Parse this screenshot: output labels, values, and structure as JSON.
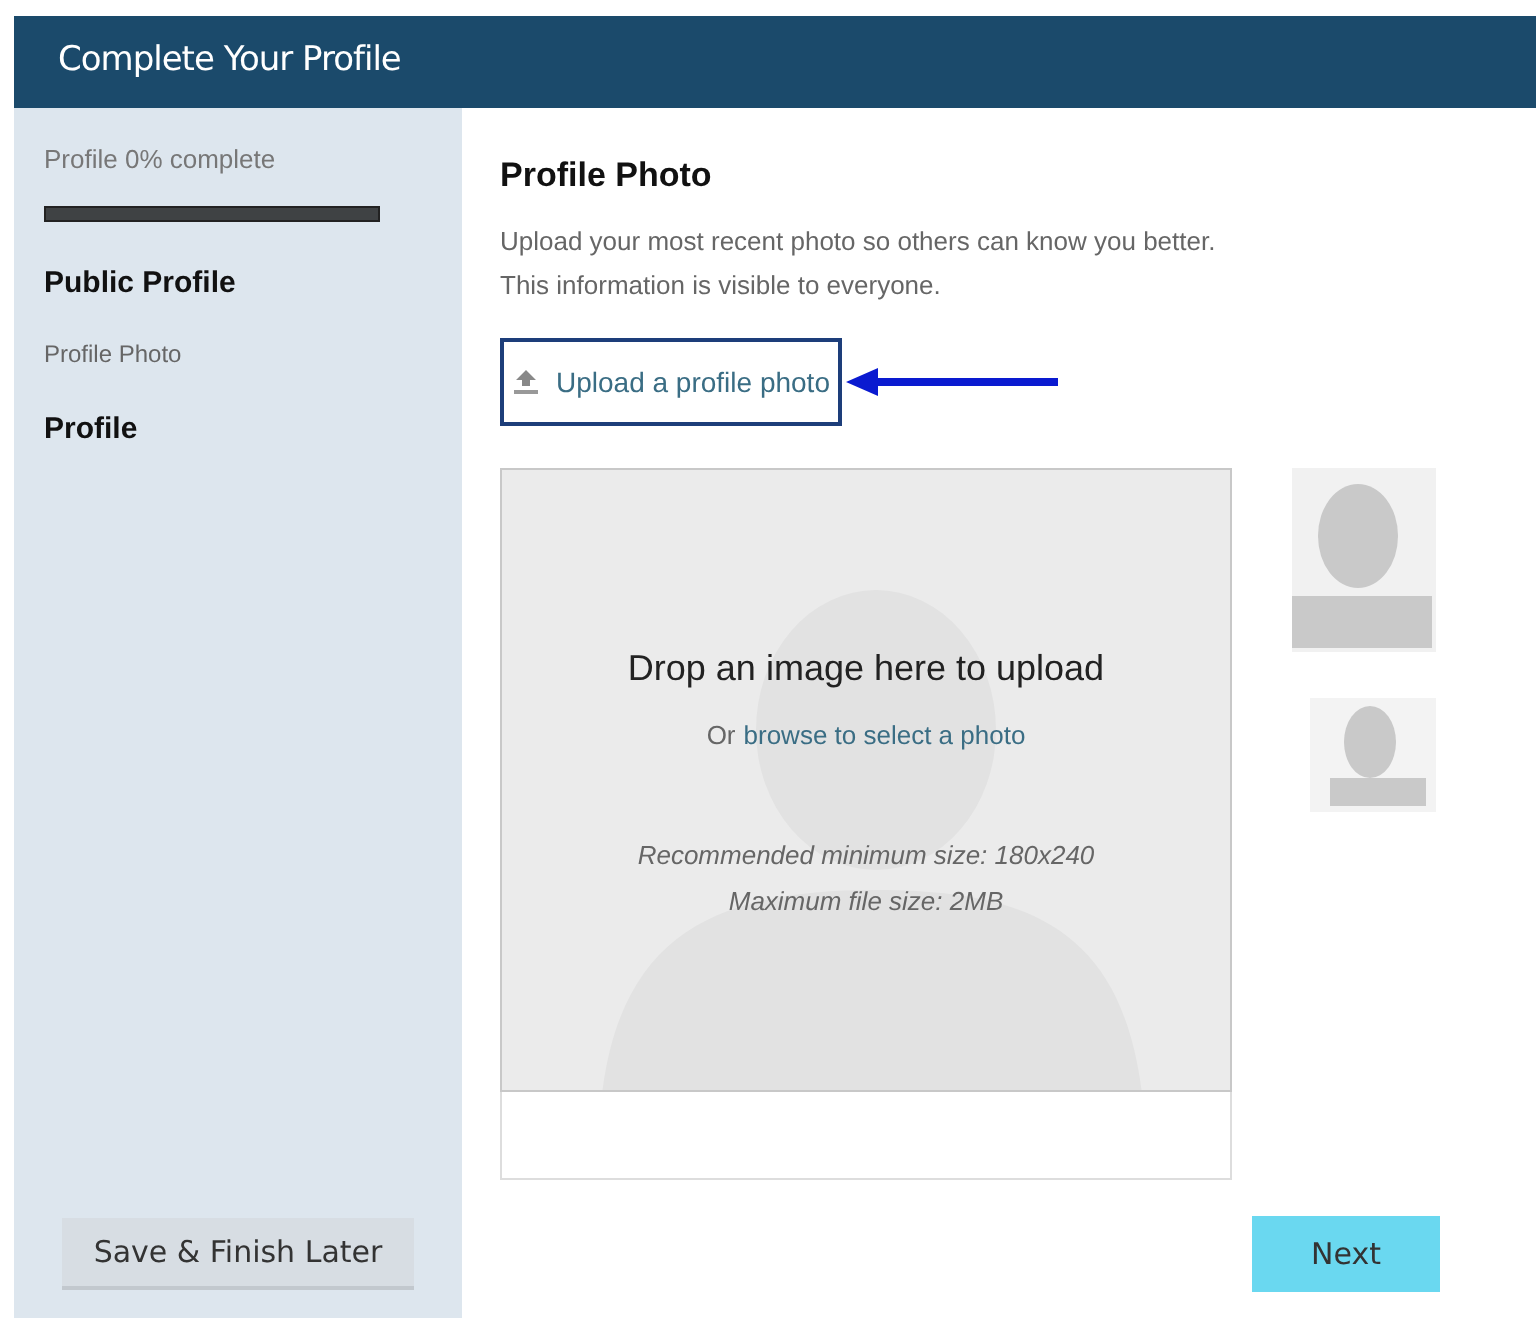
{
  "header": {
    "title": "Complete Your Profile"
  },
  "sidebar": {
    "progress_label": "Profile 0% complete",
    "progress": {
      "level": 0
    },
    "items": [
      {
        "kind": "section",
        "label": "Public Profile"
      },
      {
        "kind": "step",
        "label": "Profile Photo"
      },
      {
        "kind": "section",
        "label": "Profile"
      }
    ],
    "save_button": "Save & Finish Later"
  },
  "main": {
    "title": "Profile Photo",
    "description": [
      "Upload your most recent photo so others can know you better.",
      "This information is visible to everyone."
    ],
    "upload_link": "Upload a profile photo",
    "drop_zone": {
      "title": "Drop an image here to upload",
      "browse_prefix": "Or",
      "browse_link": "browse to select a photo",
      "hints": [
        "Recommended minimum size: 180x240",
        "Maximum file size: 2MB"
      ]
    },
    "next_button": "Next"
  }
}
